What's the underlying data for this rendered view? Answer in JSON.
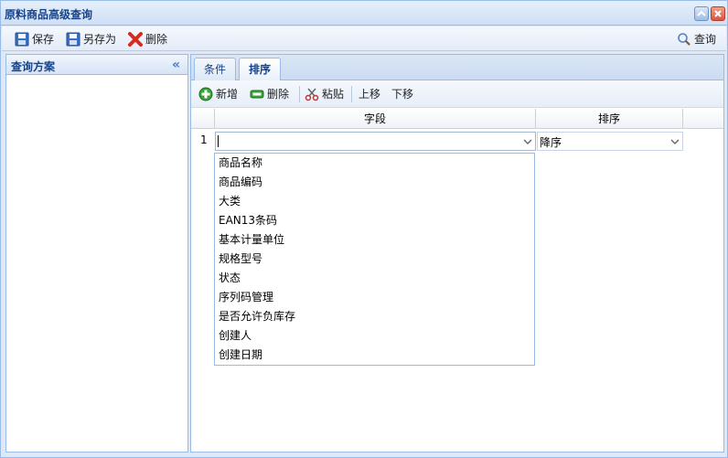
{
  "window": {
    "title": "原料商品高级查询"
  },
  "toolbar": {
    "save": "保存",
    "save_as": "另存为",
    "delete": "删除",
    "query": "查询"
  },
  "left_panel": {
    "header": "查询方案"
  },
  "tabs": [
    {
      "label": "条件"
    },
    {
      "label": "排序"
    }
  ],
  "sort_toolbar": {
    "add": "新增",
    "delete": "删除",
    "paste": "粘贴",
    "move_up": "上移",
    "move_down": "下移"
  },
  "grid": {
    "columns": [
      "字段",
      "排序"
    ],
    "rows": [
      {
        "num": "1",
        "field": "",
        "order": "降序"
      }
    ]
  },
  "dropdown": {
    "options": [
      "商品名称",
      "商品编码",
      "大类",
      "EAN13条码",
      "基本计量单位",
      "规格型号",
      "状态",
      "序列码管理",
      "是否允许负库存",
      "创建人",
      "创建日期"
    ]
  },
  "colors": {
    "title": "#15428b",
    "border": "#99bbe8",
    "background": "#dfe8f6"
  }
}
